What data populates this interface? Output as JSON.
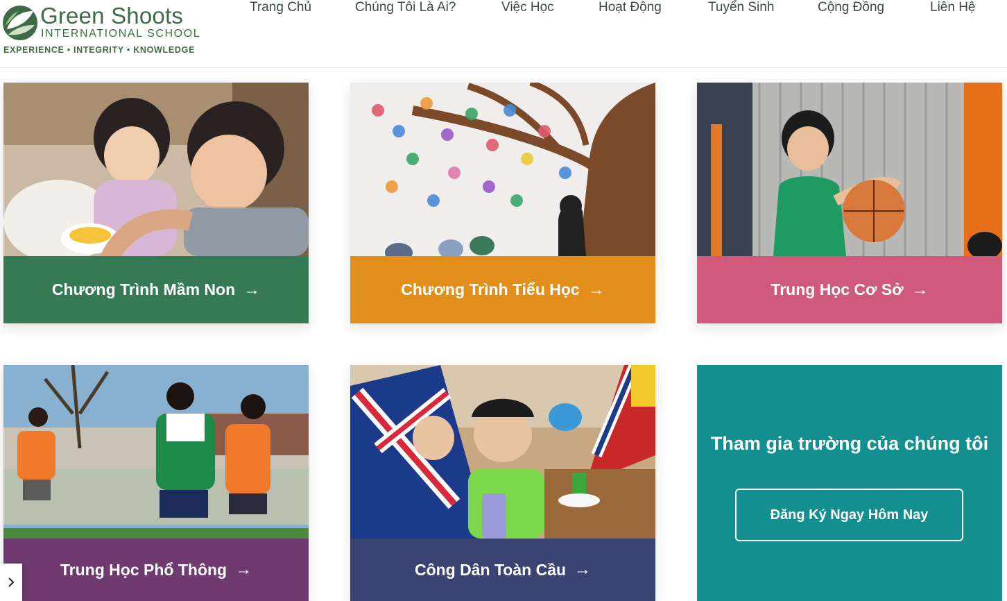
{
  "logo": {
    "name": "Green Shoots",
    "sub": "INTERNATIONAL SCHOOL",
    "tagline": "EXPERIENCE • INTEGRITY • KNOWLEDGE",
    "brand_color": "#3e6b46"
  },
  "nav": {
    "items": [
      {
        "label": "Trang Chủ"
      },
      {
        "label": "Chúng Tôi Là Ai?"
      },
      {
        "label": "Việc Học"
      },
      {
        "label": "Hoạt Động"
      },
      {
        "label": "Tuyển Sinh"
      },
      {
        "label": "Cộng Đồng"
      },
      {
        "label": "Liên Hệ"
      }
    ]
  },
  "programs": [
    {
      "label": "Chương Trình Mầm Non",
      "color": "#357a55",
      "photo": "children-eating-photo"
    },
    {
      "label": "Chương Trình Tiểu Học",
      "color": "#e18f1a",
      "photo": "handprint-tree-mural-photo"
    },
    {
      "label": "Trung Học Cơ Sở",
      "color": "#cf5a7a",
      "photo": "boy-basketball-photo"
    },
    {
      "label": "Trung Học Phổ Thông",
      "color": "#6f3b6f",
      "photo": "girls-football-photo"
    },
    {
      "label": "Công Dân Toàn Cầu",
      "color": "#3b4470",
      "photo": "child-with-flags-photo"
    }
  ],
  "arrow_glyph": "→",
  "join": {
    "title": "Tham gia trường của chúng tôi",
    "button": "Đăng Ký Ngay Hôm Nay",
    "color": "#148f8f"
  },
  "side_toggle": {
    "icon": "chevron-right-icon"
  }
}
